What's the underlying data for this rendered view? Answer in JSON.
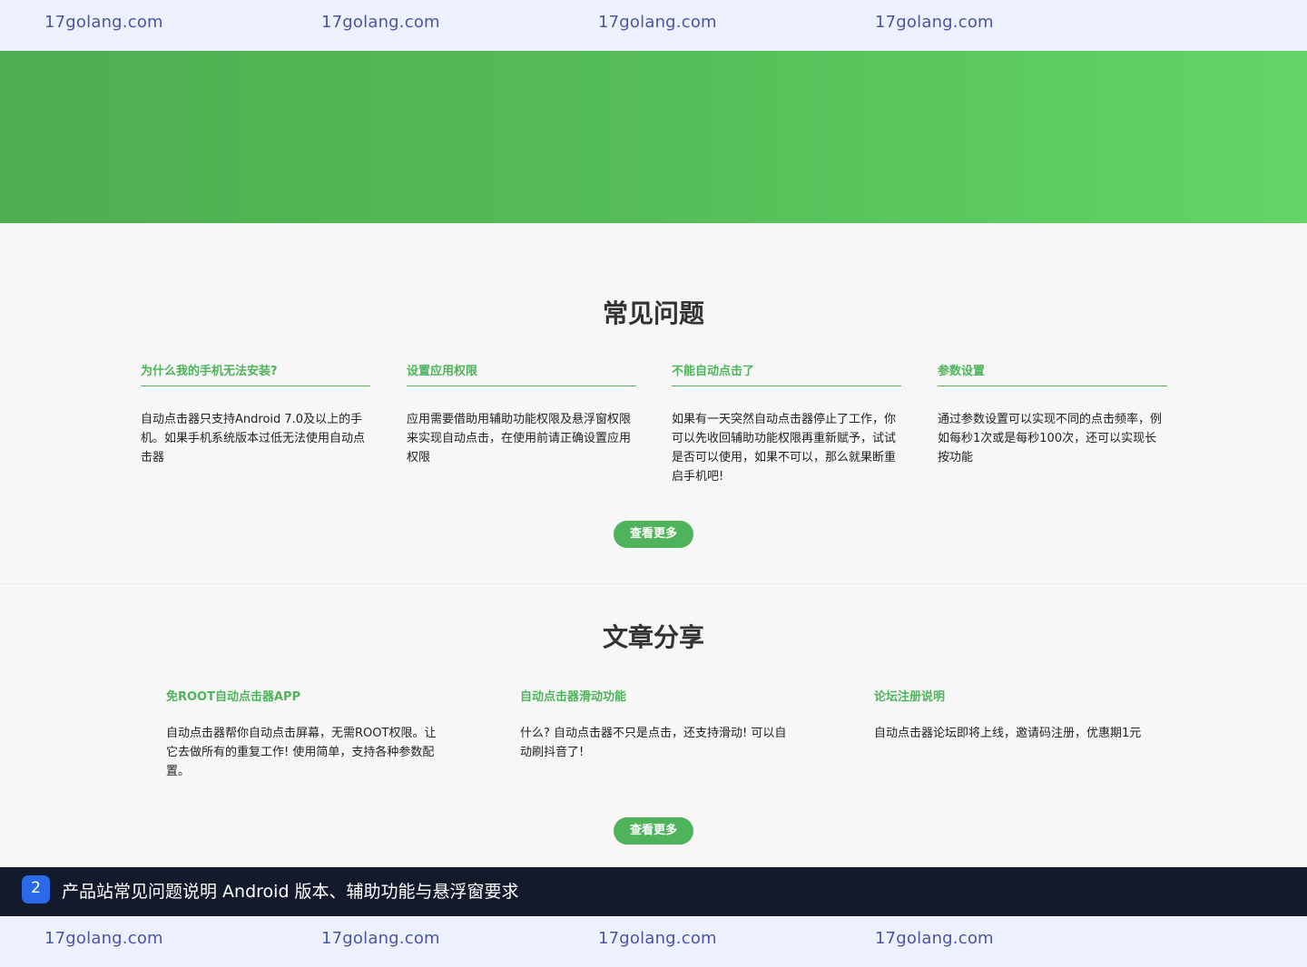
{
  "watermark": {
    "top": [
      "17golang.com",
      "17golang.com",
      "17golang.com",
      "17golang.com"
    ],
    "bottom": [
      "17golang.com",
      "17golang.com",
      "17golang.com",
      "17golang.com"
    ]
  },
  "faq": {
    "title": "常见问题",
    "items": [
      {
        "question": "为什么我的手机无法安装?",
        "answer": "自动点击器只支持Android 7.0及以上的手机。如果手机系统版本过低无法使用自动点击器"
      },
      {
        "question": "设置应用权限",
        "answer": "应用需要借助用辅助功能权限及悬浮窗权限来实现自动点击，在使用前请正确设置应用权限"
      },
      {
        "question": "不能自动点击了",
        "answer": "如果有一天突然自动点击器停止了工作，你可以先收回辅助功能权限再重新赋予，试试是否可以使用，如果不可以，那么就果断重启手机吧!"
      },
      {
        "question": "参数设置",
        "answer": "通过参数设置可以实现不同的点击频率，例如每秒1次或是每秒100次，还可以实现长按功能"
      }
    ],
    "more_label": "查看更多"
  },
  "articles": {
    "title": "文章分享",
    "items": [
      {
        "title": "免ROOT自动点击器APP",
        "desc": "自动点击器帮你自动点击屏幕，无需ROOT权限。让它去做所有的重复工作! 使用简单，支持各种参数配置。"
      },
      {
        "title": "自动点击器滑动功能",
        "desc": "什么? 自动点击器不只是点击，还支持滑动! 可以自动刷抖音了!"
      },
      {
        "title": "论坛注册说明",
        "desc": "自动点击器论坛即将上线，邀请码注册，优惠期1元"
      }
    ],
    "more_label": "查看更多"
  },
  "caption": {
    "badge": "2",
    "text": "产品站常见问题说明 Android 版本、辅助功能与悬浮窗要求"
  },
  "colors": {
    "accent_green": "#4eb35a",
    "watermark_bg": "#edf1fe",
    "caption_bg": "#131a2c",
    "badge_blue": "#2a6ae8"
  }
}
